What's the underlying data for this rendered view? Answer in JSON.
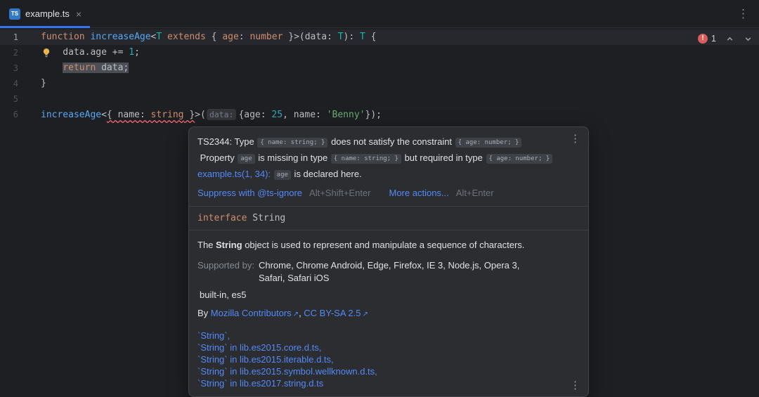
{
  "colors": {
    "accent": "#3574f0",
    "error": "#db5c5c",
    "link": "#548af7"
  },
  "window": {
    "kebab": "⋮"
  },
  "tabs": [
    {
      "label": "example.ts",
      "icon": "TS",
      "close": "×",
      "active": true
    }
  ],
  "editor": {
    "inspection": {
      "error_count": "1"
    },
    "lines": [
      {
        "num": "1",
        "highlight": true,
        "tokens": [
          {
            "t": "function",
            "c": "kw"
          },
          {
            "t": " "
          },
          {
            "t": "increaseAge",
            "c": "fn"
          },
          {
            "t": "<"
          },
          {
            "t": "T",
            "c": "tp"
          },
          {
            "t": " "
          },
          {
            "t": "extends",
            "c": "kw"
          },
          {
            "t": " { "
          },
          {
            "t": "age",
            "c": "kw"
          },
          {
            "t": ": "
          },
          {
            "t": "number",
            "c": "kw"
          },
          {
            "t": " }>("
          },
          {
            "t": "data"
          },
          {
            "t": ": "
          },
          {
            "t": "T",
            "c": "tp"
          },
          {
            "t": "): "
          },
          {
            "t": "T",
            "c": "tp"
          },
          {
            "t": " {"
          }
        ]
      },
      {
        "num": "2",
        "bulb": true,
        "tokens": [
          {
            "t": "    data.age += "
          },
          {
            "t": "1",
            "c": "num"
          },
          {
            "t": ";"
          }
        ]
      },
      {
        "num": "3",
        "tokens": [
          {
            "t": "    "
          },
          {
            "t": "return",
            "c": "kw sel"
          },
          {
            "t": " data;",
            "c": "sel"
          }
        ]
      },
      {
        "num": "4",
        "tokens": [
          {
            "t": "}"
          }
        ]
      },
      {
        "num": "5",
        "tokens": []
      },
      {
        "num": "6",
        "tokens": [
          {
            "t": "increaseAge",
            "c": "fn"
          },
          {
            "t": "<"
          },
          {
            "t": "{ name: ",
            "c": "err"
          },
          {
            "t": "string",
            "c": "kw err"
          },
          {
            "t": " }",
            "c": "err"
          },
          {
            "t": ">("
          },
          {
            "t": "data:",
            "c": "inlay"
          },
          {
            "t": "{age: "
          },
          {
            "t": "25",
            "c": "num"
          },
          {
            "t": ", name: "
          },
          {
            "t": "'Benny'",
            "c": "str"
          },
          {
            "t": "});"
          }
        ]
      }
    ]
  },
  "popup": {
    "error": {
      "kebab": "⋮",
      "rows": [
        [
          {
            "t": "TS2344: Type "
          },
          {
            "t": "{ name: string; }",
            "c": "chip"
          },
          {
            "t": " does not satisfy the constraint "
          },
          {
            "t": "{ age: number; }",
            "c": "chip"
          }
        ],
        [
          {
            "t": " Property "
          },
          {
            "t": "age",
            "c": "chip"
          },
          {
            "t": " is missing in type "
          },
          {
            "t": "{ name: string; }",
            "c": "chip"
          },
          {
            "t": " but required in type "
          },
          {
            "t": "{ age: number; }",
            "c": "chip"
          }
        ],
        [
          {
            "t": "example.ts(1, 34):",
            "c": "link"
          },
          {
            "t": " "
          },
          {
            "t": "age",
            "c": "chip"
          },
          {
            "t": " is declared here."
          }
        ]
      ],
      "actions": [
        {
          "label": "Suppress with @ts-ignore",
          "shortcut": "Alt+Shift+Enter"
        },
        {
          "label": "More actions...",
          "shortcut": "Alt+Enter"
        }
      ]
    },
    "signature": [
      {
        "t": "interface",
        "c": "kw"
      },
      {
        "t": " String"
      }
    ],
    "doc": {
      "description": [
        {
          "t": "The "
        },
        {
          "t": "String",
          "c": "b"
        },
        {
          "t": " object is used to represent and manipulate a sequence of characters."
        }
      ],
      "supported_label": "Supported by:",
      "supported_lines": [
        "Chrome, Chrome Android, Edge, Firefox, IE 3, Node.js, Opera 3,",
        "Safari, Safari iOS"
      ],
      "spec": "built-in, es5",
      "byline": [
        {
          "t": "By "
        },
        {
          "t": "Mozilla Contributors",
          "c": "elink"
        },
        {
          "t": ", "
        },
        {
          "t": "CC BY-SA 2.5",
          "c": "elink"
        }
      ],
      "links": [
        "`String`,",
        "`String` in lib.es2015.core.d.ts,",
        "`String` in lib.es2015.iterable.d.ts,",
        "`String` in lib.es2015.symbol.wellknown.d.ts,",
        "`String` in lib.es2017.string.d.ts"
      ],
      "kebab": "⋮"
    }
  }
}
